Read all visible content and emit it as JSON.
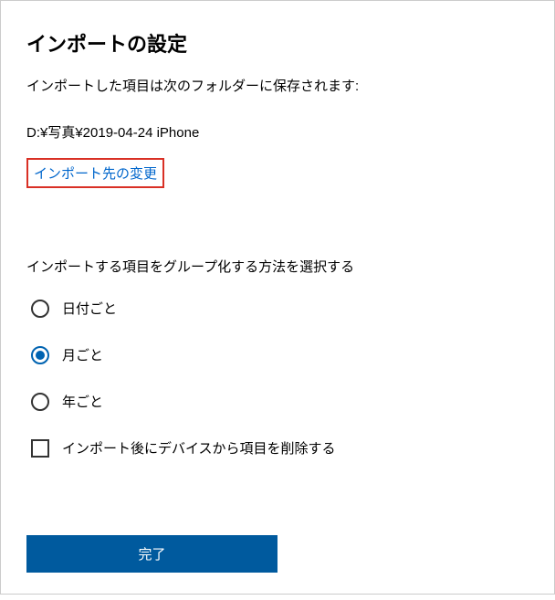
{
  "title": "インポートの設定",
  "subtitle": "インポートした項目は次のフォルダーに保存されます:",
  "path": "D:¥写真¥2019-04-24 iPhone",
  "change_link": "インポート先の変更",
  "group_label": "インポートする項目をグループ化する方法を選択する",
  "radio_options": {
    "by_date": "日付ごと",
    "by_month": "月ごと",
    "by_year": "年ごと"
  },
  "selected_option": "by_month",
  "delete_checkbox": "インポート後にデバイスから項目を削除する",
  "done_button": "完了"
}
